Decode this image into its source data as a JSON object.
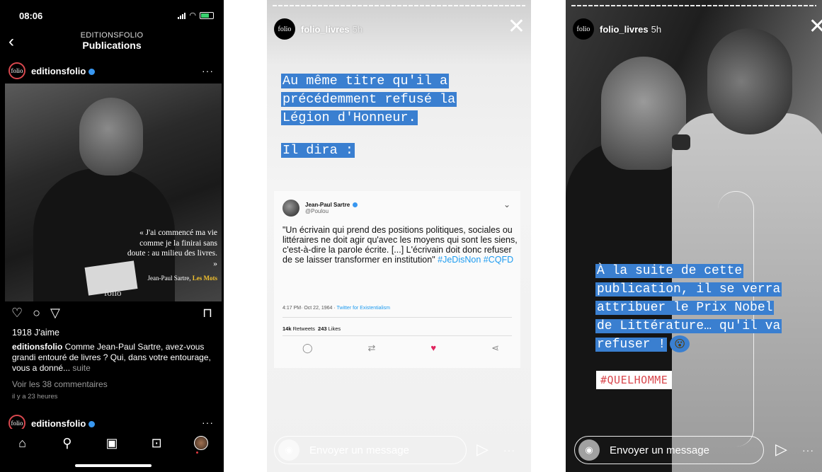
{
  "panel1": {
    "status_time": "08:06",
    "header_sub": "EDITIONSFOLIO",
    "header_title": "Publications",
    "back_icon": "‹",
    "avatar_text": "folio",
    "username": "editionsfolio",
    "more_icon": "···",
    "quote": "« J'ai commencé ma vie comme je la finirai sans doute : au milieu des livres. »",
    "quote_author": "Jean-Paul Sartre,",
    "quote_book": "Les Mots",
    "photo_mark": "folio",
    "likes": "1918 J'aime",
    "caption_user": "editionsfolio",
    "caption_text": "Comme Jean-Paul Sartre, avez-vous grandi entouré de livres ? Qui, dans votre entourage, vous a donné...",
    "caption_more": "suite",
    "comments": "Voir les 38 commentaires",
    "time_ago": "il y a 23 heures",
    "next_username": "editionsfolio",
    "icons": [
      "heart-icon",
      "comment-icon",
      "share-icon",
      "bookmark-icon"
    ],
    "tabs": [
      "home-icon",
      "search-icon",
      "reels-icon",
      "shop-icon",
      "profile-avatar"
    ]
  },
  "panel2": {
    "avatar_text": "folio",
    "username": "folio_livres",
    "time": "5h",
    "close_icon": "✕",
    "block1": [
      "Au même titre qu'il a",
      "précédemment refusé la",
      "Légion d'Honneur."
    ],
    "block2": "Il dira :",
    "tweet": {
      "name": "Jean-Paul Sartre",
      "handle": "@Poulou",
      "text": "\"Un écrivain qui prend des positions politiques, sociales ou littéraires ne doit agir qu'avec les moyens qui sont les siens, c'est-à-dire la parole écrite. [...] L'écrivain doit donc refuser de se laisser transformer en institution\"",
      "tags": "#JeDisNon #CQFD",
      "date": "4:17 PM· Oct 22, 1964 ·",
      "source": "Twitter for Existentialism",
      "retweets": "14k",
      "retweets_label": "Retweets",
      "likes": "243",
      "likes_label": "Likes"
    },
    "message_placeholder": "Envoyer un message"
  },
  "panel3": {
    "avatar_text": "folio",
    "username": "folio_livres",
    "time": "5h",
    "close_icon": "✕",
    "lines": [
      "À la suite de cette",
      "publication, il se verra",
      "attribuer le Prix Nobel",
      "de Littérature… qu'il va",
      "refuser !"
    ],
    "emoji": "😮",
    "hashtag": "#QUELHOMME",
    "message_placeholder": "Envoyer un message"
  },
  "colors": {
    "highlight": "#3a7fd0",
    "hashtag_red": "#d9484e",
    "verified": "#3897f0",
    "twitter_blue": "#1d9bf0",
    "heart_red": "#e0245e"
  }
}
